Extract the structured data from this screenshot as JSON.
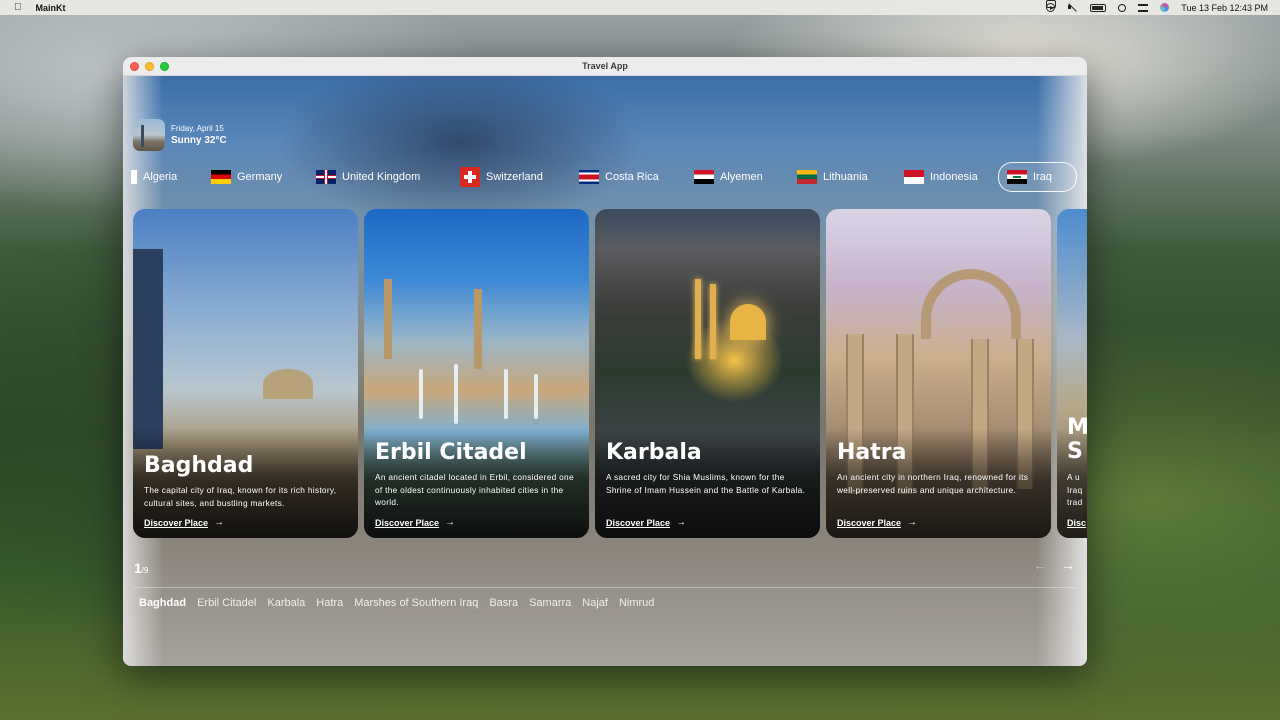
{
  "menubar": {
    "apple": "",
    "app_name": "MainKt",
    "datetime": "Tue 13 Feb  12:43 PM"
  },
  "window": {
    "title": "Travel App"
  },
  "weather": {
    "date": "Friday, April 15",
    "condition": "Sunny 32°C"
  },
  "countries": [
    {
      "label": "Algeria",
      "flag": "dz"
    },
    {
      "label": "Germany",
      "flag": "de"
    },
    {
      "label": "United Kingdom",
      "flag": "uk"
    },
    {
      "label": "Switzerland",
      "flag": "ch"
    },
    {
      "label": "Costa Rica",
      "flag": "cr"
    },
    {
      "label": "Alyemen",
      "flag": "ye"
    },
    {
      "label": "Lithuania",
      "flag": "lt"
    },
    {
      "label": "Indonesia",
      "flag": "id"
    },
    {
      "label": "Iraq",
      "flag": "iq",
      "selected": true
    }
  ],
  "cards": [
    {
      "title": "Baghdad",
      "description": "The capital city of Iraq, known for its rich history, cultural sites, and bustling markets.",
      "link": "Discover Place"
    },
    {
      "title": "Erbil Citadel",
      "description": "An ancient citadel located in Erbil, considered one of the oldest continuously inhabited cities in the world.",
      "link": "Discover Place"
    },
    {
      "title": "Karbala",
      "description": "A sacred city for Shia Muslims, known for the Shrine of Imam Hussein and the Battle of Karbala.",
      "link": "Discover Place"
    },
    {
      "title": "Hatra",
      "description": "An ancient city in northern Iraq, renowned for its well-preserved ruins and unique architecture.",
      "link": "Discover Place"
    },
    {
      "title": "M\nS",
      "description": "A u\nIraq\ntrad",
      "link": "Disc"
    }
  ],
  "pager": {
    "current": "1",
    "total": "/9"
  },
  "nav": {
    "prev": "←",
    "next": "→"
  },
  "places": [
    "Baghdad",
    "Erbil Citadel",
    "Karbala",
    "Hatra",
    "Marshes of Southern Iraq",
    "Basra",
    "Samarra",
    "Najaf",
    "Nimrud"
  ],
  "colors": {
    "accent": "#ffffff",
    "window_bg_top": "#3c6ea8"
  }
}
